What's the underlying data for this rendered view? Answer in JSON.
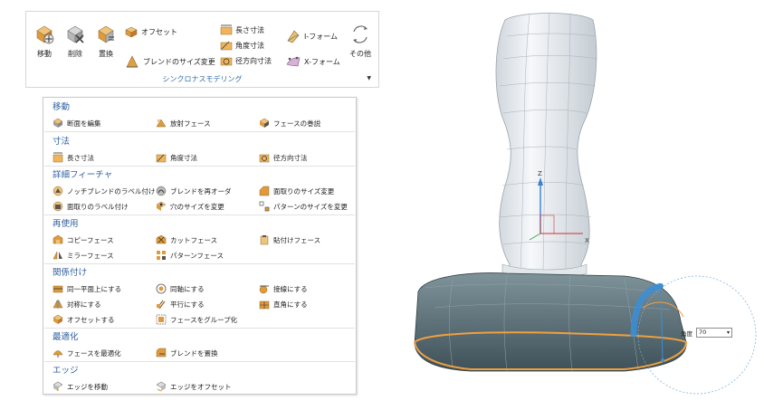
{
  "ribbon": {
    "move_label": "移動",
    "delete_label": "削除",
    "replace_label": "置換",
    "offset_label": "オフセット",
    "resize_blend_label": "ブレンドのサイズ変更",
    "length_dim_label": "長さ寸法",
    "angle_dim_label": "角度寸法",
    "radial_dim_label": "径方向寸法",
    "iform_label": "I-フォーム",
    "xform_label": "X-フォーム",
    "more_label": "その他",
    "group_label": "シンクロナスモデリング"
  },
  "menu": {
    "sections": [
      {
        "title": "移動",
        "items": [
          "断面を編集",
          "放射フェース",
          "フェースの巻説"
        ]
      },
      {
        "title": "寸法",
        "items": [
          "長さ寸法",
          "角度寸法",
          "径方向寸法"
        ]
      },
      {
        "title": "詳細フィーチャ",
        "items": [
          "ノッチブレンドのラベル付け",
          "ブレンドを再オーダ",
          "面取りのサイズ変更",
          "面取りのラベル付け",
          "穴のサイズを変更",
          "パターンのサイズを変更"
        ]
      },
      {
        "title": "再使用",
        "items": [
          "コピーフェース",
          "カットフェース",
          "貼付けフェース",
          "ミラーフェース",
          "パターンフェース"
        ]
      },
      {
        "title": "関係付け",
        "items": [
          "同一平面上にする",
          "同軸にする",
          "接線にする",
          "対称にする",
          "平行にする",
          "直角にする",
          "オフセットする",
          "フェースをグループ化"
        ]
      },
      {
        "title": "最適化",
        "items": [
          "フェースを最適化",
          "ブレンドを置換"
        ]
      },
      {
        "title": "エッジ",
        "items": [
          "エッジを移動",
          "エッジをオフセット"
        ]
      }
    ]
  },
  "viewport": {
    "axis_x": "X",
    "axis_z": "Z",
    "angle_label": "角度",
    "angle_value": "70"
  },
  "colors": {
    "accent": "#2f5f9f",
    "model": "#5e7178",
    "edge_highlight": "#f0a040",
    "handle": "#3a8fd8"
  }
}
